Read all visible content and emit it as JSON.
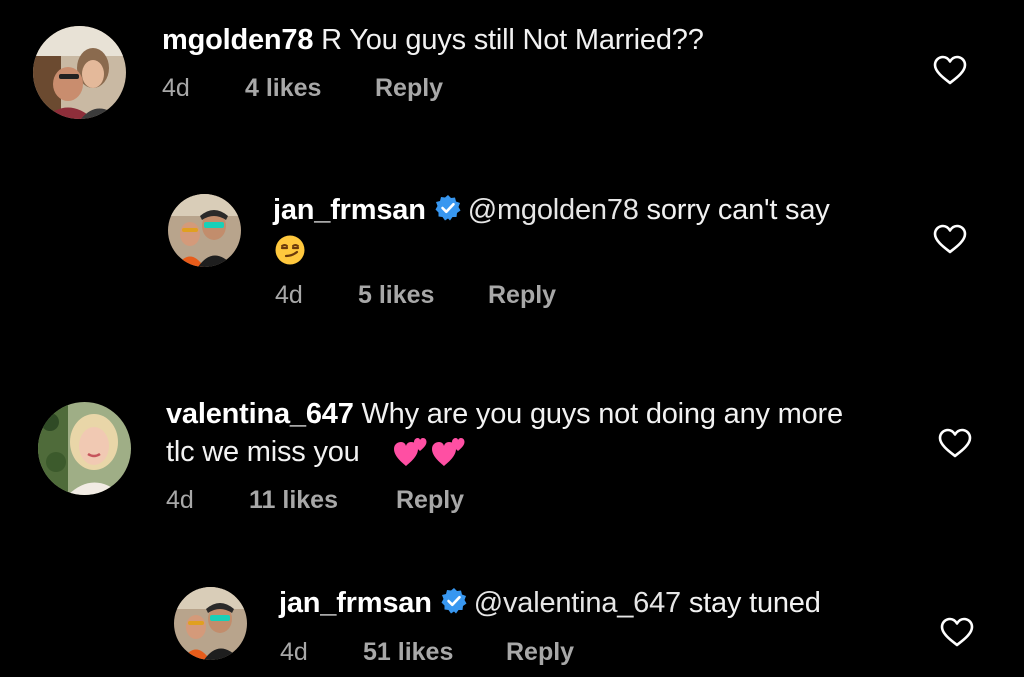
{
  "comments": [
    {
      "username": "mgolden78",
      "text": "R You guys still Not Married??",
      "time": "4d",
      "likes": "4 likes",
      "reply": "Reply",
      "verified": false
    },
    {
      "username": "jan_frmsan",
      "mention": "@mgolden78",
      "text": "sorry can't say",
      "time": "4d",
      "likes": "5 likes",
      "reply": "Reply",
      "verified": true,
      "emoji": "smirk-emoji"
    },
    {
      "username": "valentina_647",
      "text": "Why are you guys not doing any more",
      "text_line2": "tlc we miss you",
      "time": "4d",
      "likes": "11 likes",
      "reply": "Reply",
      "verified": false,
      "emoji": "two-hearts-emoji"
    },
    {
      "username": "jan_frmsan",
      "mention": "@valentina_647",
      "text": "stay tuned",
      "time": "4d",
      "likes": "51 likes",
      "reply": "Reply",
      "verified": true
    }
  ],
  "colors": {
    "background": "#000000",
    "text": "#ffffff",
    "secondary": "#a8a8a8",
    "verified": "#3897f0"
  }
}
